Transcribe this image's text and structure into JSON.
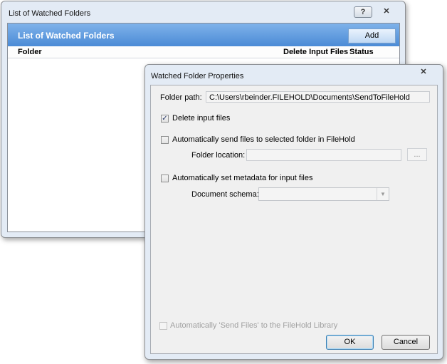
{
  "list_window": {
    "title": "List of Watched Folders",
    "help_glyph": "?",
    "close_glyph": "✕",
    "header_title": "List of Watched Folders",
    "add_label": "Add",
    "columns": {
      "folder": "Folder",
      "delete_input_files": "Delete Input Files",
      "status": "Status"
    }
  },
  "props_dialog": {
    "title": "Watched Folder Properties",
    "close_glyph": "✕",
    "folder_path_label": "Folder path:",
    "folder_path_value": "C:\\Users\\rbeinder.FILEHOLD\\Documents\\SendToFileHold",
    "delete_input_files_label": "Delete input files",
    "delete_input_files_checked": true,
    "auto_send_label": "Automatically send files to selected folder in FileHold",
    "auto_send_checked": false,
    "folder_location_label": "Folder location:",
    "folder_location_value": "",
    "browse_label": "...",
    "auto_metadata_label": "Automatically set metadata for input files",
    "auto_metadata_checked": false,
    "document_schema_label": "Document schema:",
    "document_schema_value": "",
    "auto_send_library_label": "Automatically 'Send Files' to the FileHold Library",
    "auto_send_library_checked": false,
    "ok_label": "OK",
    "cancel_label": "Cancel",
    "check_glyph": "✓",
    "combo_arrow_glyph": "▼"
  }
}
